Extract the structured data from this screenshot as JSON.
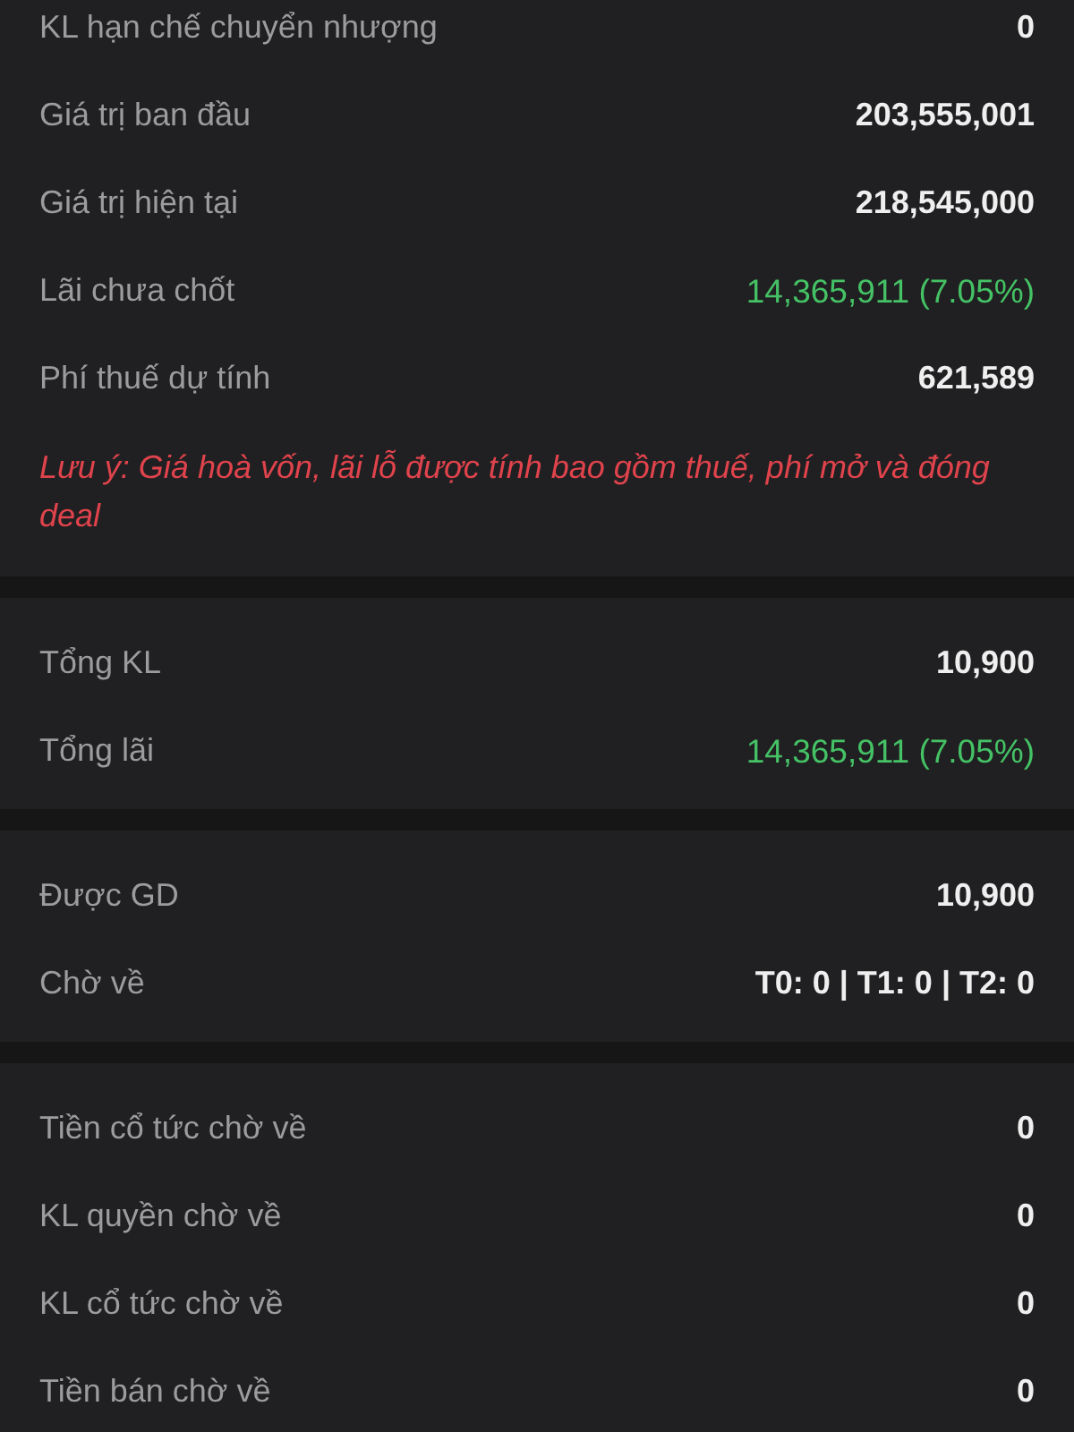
{
  "sections": [
    {
      "rows": [
        {
          "label": "KL hạn chế chuyển nhượng",
          "value": "0",
          "positive": false
        },
        {
          "label": "Giá trị ban đầu",
          "value": "203,555,001",
          "positive": false
        },
        {
          "label": "Giá trị hiện tại",
          "value": "218,545,000",
          "positive": false
        },
        {
          "label": "Lãi chưa chốt",
          "value": "14,365,911 (7.05%)",
          "positive": true
        },
        {
          "label": "Phí thuế dự tính",
          "value": "621,589",
          "positive": false
        }
      ],
      "note": "Lưu ý: Giá hoà vốn, lãi lỗ được tính bao gồm thuế, phí mở và đóng deal"
    },
    {
      "rows": [
        {
          "label": "Tổng KL",
          "value": "10,900",
          "positive": false
        },
        {
          "label": "Tổng lãi",
          "value": "14,365,911 (7.05%)",
          "positive": true
        }
      ]
    },
    {
      "rows": [
        {
          "label": "Được GD",
          "value": "10,900",
          "positive": false
        },
        {
          "label": "Chờ về",
          "value": "T0: 0 | T1: 0 | T2: 0",
          "positive": false
        }
      ]
    },
    {
      "rows": [
        {
          "label": "Tiền cổ tức chờ về",
          "value": "0",
          "positive": false
        },
        {
          "label": "KL quyền chờ về",
          "value": "0",
          "positive": false
        },
        {
          "label": "KL cổ tức chờ về",
          "value": "0",
          "positive": false
        },
        {
          "label": "Tiền bán chờ về",
          "value": "0",
          "positive": false
        }
      ]
    }
  ]
}
